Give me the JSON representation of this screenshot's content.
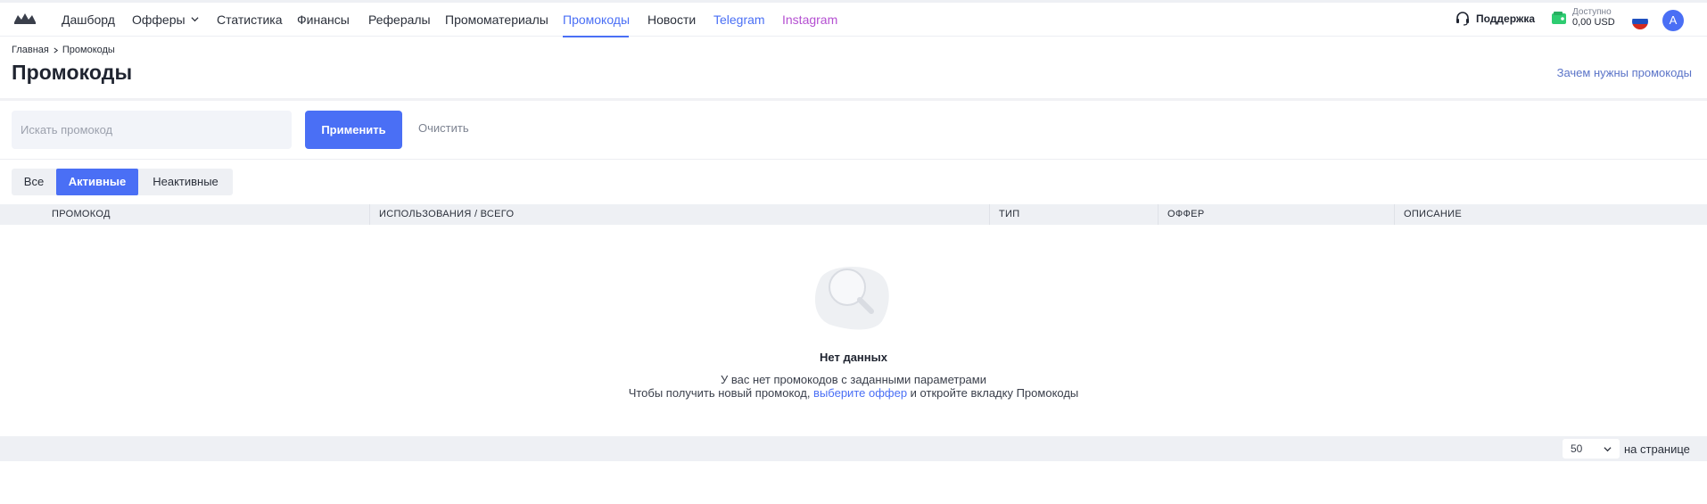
{
  "nav": {
    "items": [
      {
        "label": "Дашборд"
      },
      {
        "label": "Офферы"
      },
      {
        "label": "Статистика"
      },
      {
        "label": "Финансы"
      },
      {
        "label": "Рефералы"
      },
      {
        "label": "Промоматериалы"
      },
      {
        "label": "Промокоды"
      },
      {
        "label": "Новости"
      },
      {
        "label": "Telegram"
      },
      {
        "label": "Instagram"
      }
    ],
    "active_item": "Промокоды"
  },
  "header": {
    "support_label": "Поддержка",
    "balance_label": "Доступно",
    "balance_value": "0,00 USD",
    "avatar_letter": "A"
  },
  "breadcrumb": {
    "home": "Главная",
    "current": "Промокоды"
  },
  "page": {
    "title": "Промокоды",
    "help_link": "Зачем нужны промокоды"
  },
  "filters": {
    "search_placeholder": "Искать промокод",
    "search_value": "",
    "apply_label": "Применить",
    "clear_label": "Очистить"
  },
  "tabs": [
    {
      "label": "Все"
    },
    {
      "label": "Активные"
    },
    {
      "label": "Неактивные"
    }
  ],
  "active_tab": "Активные",
  "table": {
    "columns": [
      "ПРОМОКОД",
      "ИСПОЛЬЗОВАНИЯ / ВСЕГО",
      "ТИП",
      "ОФФЕР",
      "ОПИСАНИЕ"
    ],
    "rows": []
  },
  "empty": {
    "title": "Нет данных",
    "line1": "У вас нет промокодов с заданными параметрами",
    "line2_before": "Чтобы получить новый промокод, ",
    "line2_link": "выберите оффер",
    "line2_after": " и откройте вкладку Промокоды"
  },
  "pagination": {
    "per_page_value": "50",
    "per_page_label": "на странице"
  },
  "colors": {
    "accent": "#4a6ff5",
    "telegram": "#4a6ff5",
    "instagram": "#b44fd1",
    "wallet": "#2ecc71",
    "header_bg": "#eef0f4"
  },
  "icons": {
    "logo": "brand-logo-icon",
    "support": "headset-icon",
    "wallet": "wallet-icon",
    "language": "russia-flag-icon",
    "dropdown": "chevron-down-icon",
    "breadcrumb_separator": "chevron-right-icon",
    "empty_state": "magnifier-illustration-icon"
  }
}
